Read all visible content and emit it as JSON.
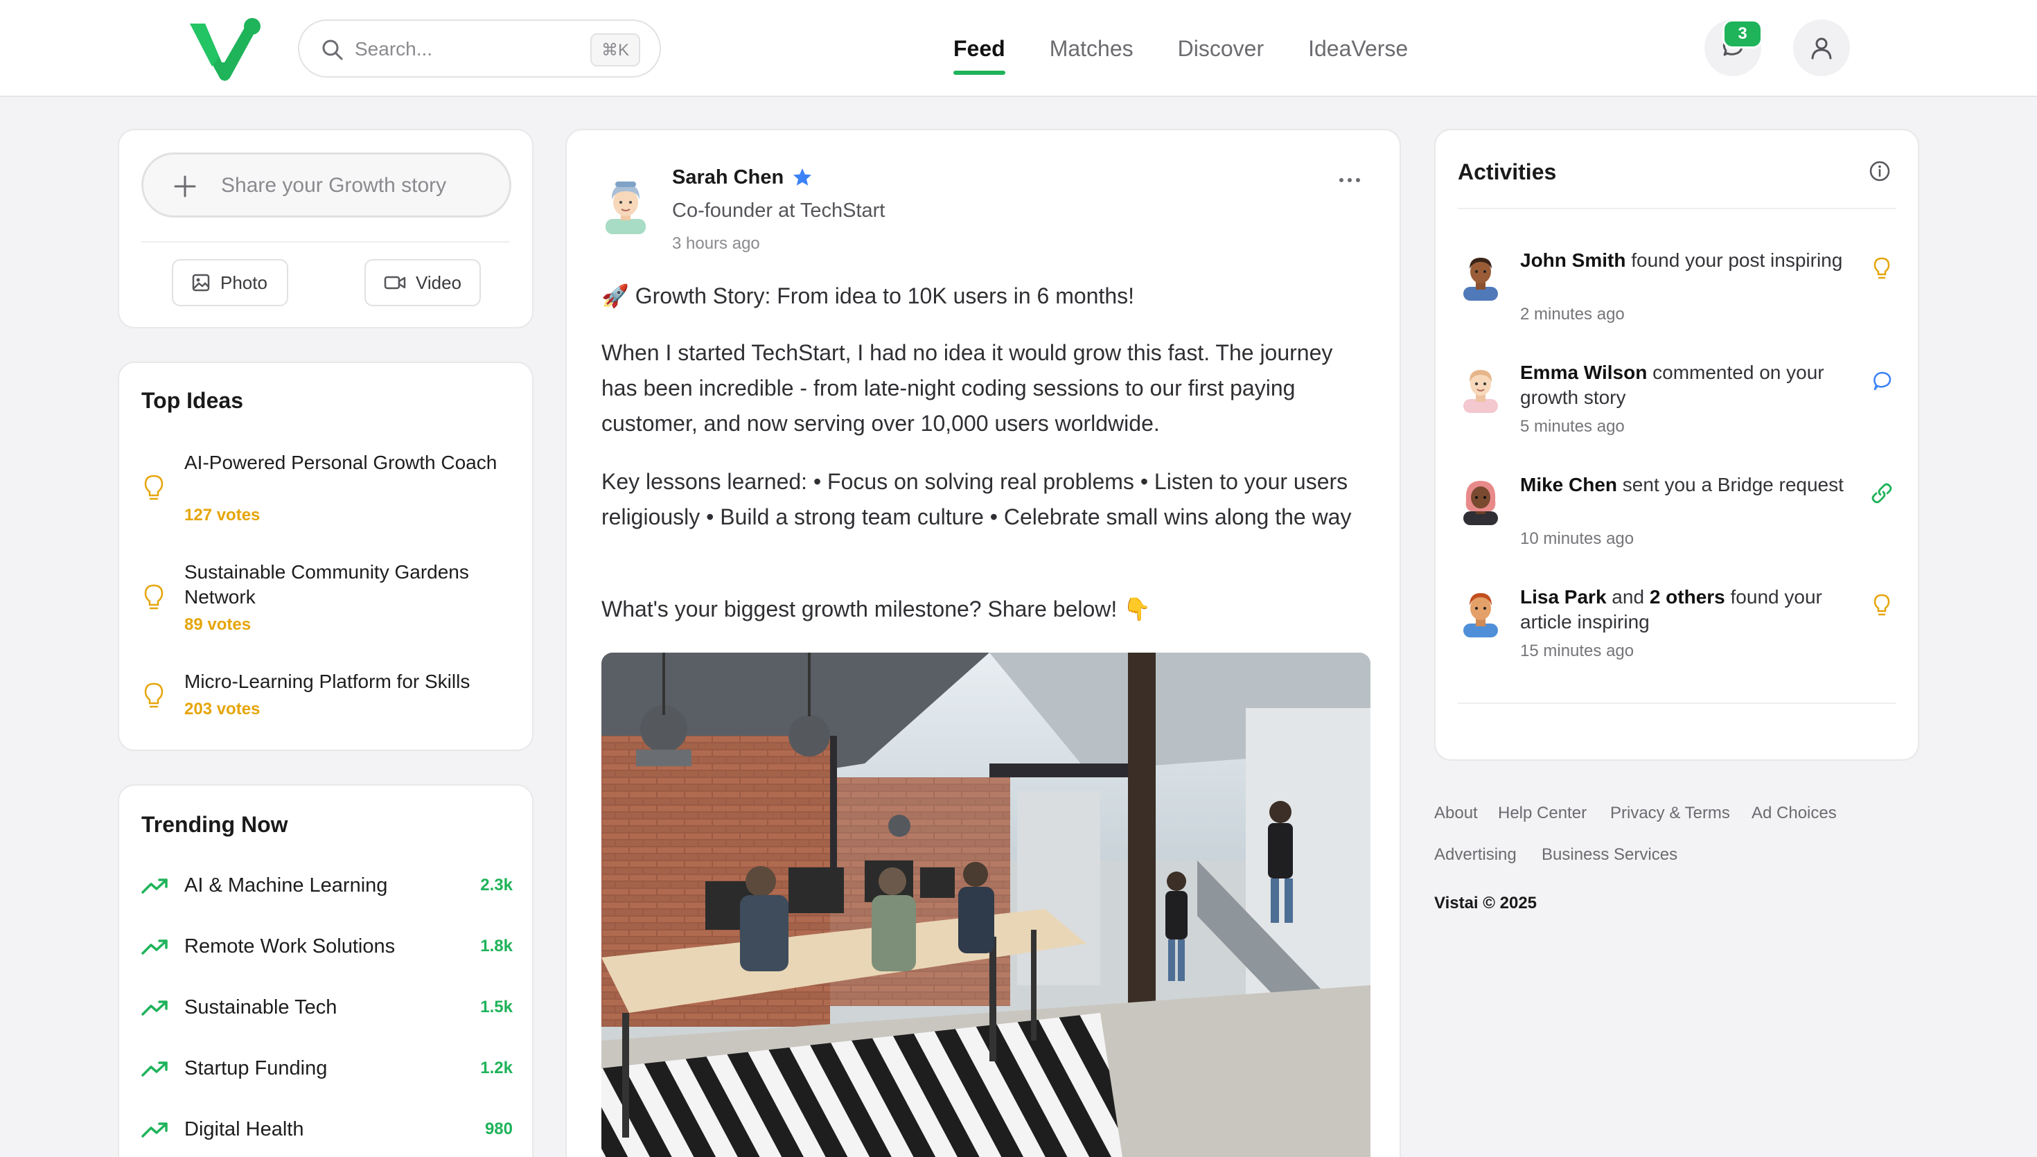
{
  "header": {
    "search_placeholder": "Search...",
    "search_shortcut": "⌘K",
    "nav": [
      "Feed",
      "Matches",
      "Discover",
      "IdeaVerse"
    ],
    "active_nav": "Feed",
    "message_badge": "3"
  },
  "share": {
    "placeholder": "Share your Growth story",
    "photo_label": "Photo",
    "video_label": "Video"
  },
  "top_ideas": {
    "title": "Top Ideas",
    "items": [
      {
        "title": "AI-Powered Personal Growth Coach",
        "votes": "127 votes"
      },
      {
        "title": "Sustainable Community Gardens Network",
        "votes": "89 votes"
      },
      {
        "title": "Micro-Learning Platform for Skills",
        "votes": "203 votes"
      }
    ]
  },
  "trending": {
    "title": "Trending Now",
    "items": [
      {
        "name": "AI & Machine Learning",
        "count": "2.3k"
      },
      {
        "name": "Remote Work Solutions",
        "count": "1.8k"
      },
      {
        "name": "Sustainable Tech",
        "count": "1.5k"
      },
      {
        "name": "Startup Funding",
        "count": "1.2k"
      },
      {
        "name": "Digital Health",
        "count": "980"
      }
    ]
  },
  "post": {
    "author": "Sarah Chen",
    "role": "Co-founder at TechStart",
    "time": "3 hours ago",
    "headline": "🚀 Growth Story: From idea to 10K users in 6 months!",
    "paragraph1": "When I started TechStart, I had no idea it would grow this fast. The journey has been incredible - from late-night coding sessions to our first paying customer, and now serving over 10,000 users worldwide.",
    "paragraph2": "Key lessons learned: • Focus on solving real problems • Listen to your users religiously • Build a strong team culture • Celebrate small wins along the way",
    "paragraph3": "What's your biggest growth milestone? Share below! 👇"
  },
  "activities": {
    "title": "Activities",
    "items": [
      {
        "name": "John Smith",
        "action": " found your post inspiring",
        "time": "2 minutes ago",
        "icon": "lightbulb-icon"
      },
      {
        "name": "Emma Wilson",
        "action": " commented on your growth story",
        "time": "5 minutes ago",
        "icon": "comment-icon"
      },
      {
        "name": "Mike Chen",
        "action": " sent you a Bridge request",
        "time": "10 minutes ago",
        "icon": "link-icon"
      },
      {
        "name": "Lisa Park",
        "action_mid": " and ",
        "others": "2 others",
        "action": " found your article inspiring",
        "time": "15 minutes ago",
        "icon": "lightbulb-icon"
      }
    ]
  },
  "footer": {
    "links": [
      "About",
      "Help Center",
      "Privacy & Terms",
      "Ad Choices",
      "Advertising",
      "Business Services"
    ],
    "copyright": "Vistai © 2025"
  },
  "colors": {
    "brand_green": "#1fb35a",
    "votes_amber": "#e5a50a",
    "link_blue": "#3b82f6"
  }
}
